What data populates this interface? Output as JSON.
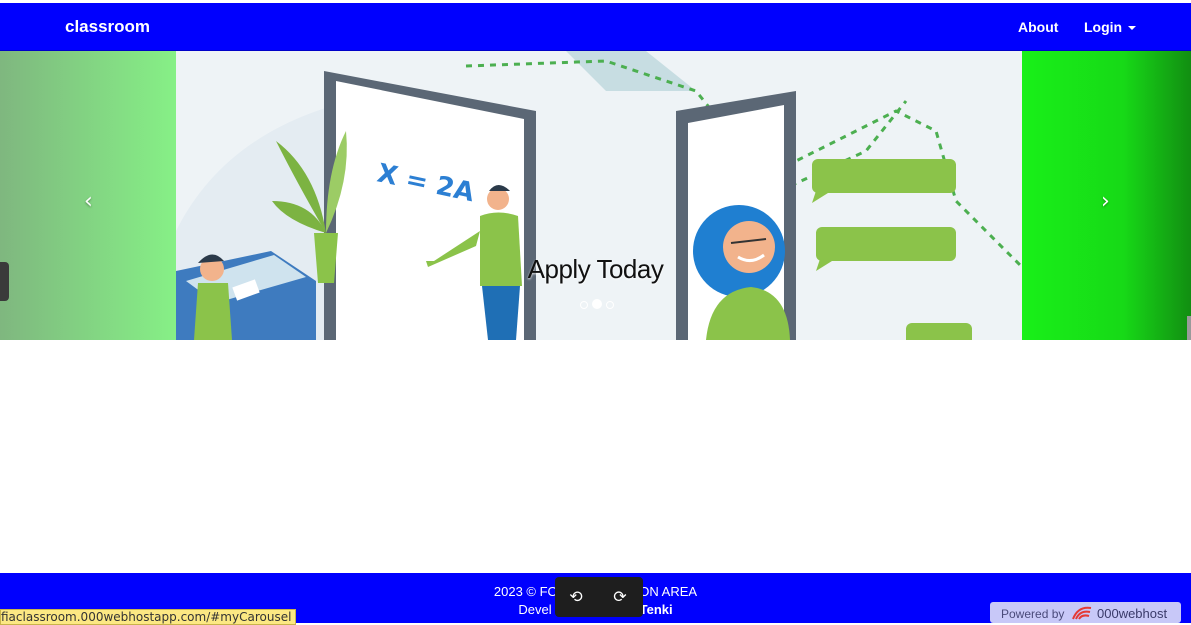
{
  "navbar": {
    "brand": "classroom",
    "links": {
      "about": "About",
      "login": "Login"
    },
    "bg_color": "#0000fe"
  },
  "carousel": {
    "caption": "Apply Today",
    "prev_icon": "chevron-left-icon",
    "prev_glyph": "‹",
    "next_icon": "chevron-right-icon",
    "next_glyph": "›",
    "slide_count": 3,
    "active_slide": 2,
    "slide_formula": "X = 2A"
  },
  "footer": {
    "line1": "2023 © FO",
    "line1_tail": "ION AREA",
    "line2_prefix": "Devel",
    "line2_name": "Tenki"
  },
  "media_controls": {
    "back_icon": "rewind-icon",
    "back_glyph": "⟲",
    "forward_icon": "forward-icon",
    "forward_glyph": "⟳"
  },
  "status_bar": {
    "url": "fiaclassroom.000webhostapp.com/#myCarousel"
  },
  "powered_badge": {
    "label": "Powered by",
    "brand": "000webhost"
  }
}
